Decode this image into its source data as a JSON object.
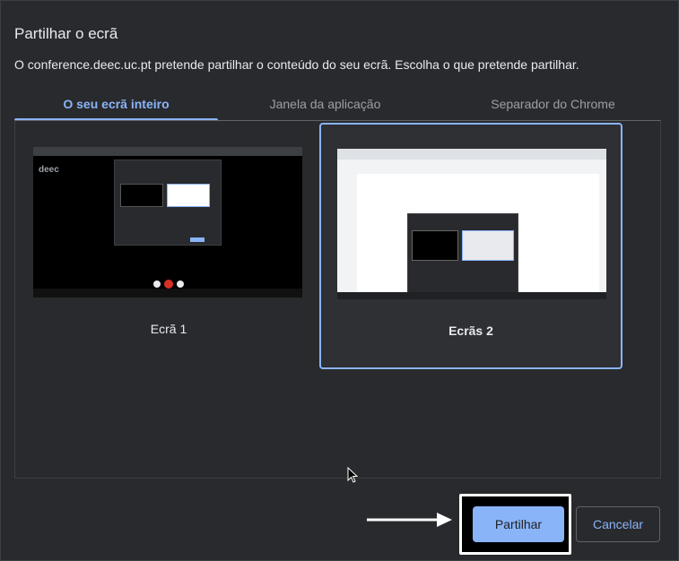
{
  "dialog": {
    "title": "Partilhar o ecrã",
    "subtitle": "O conference.deec.uc.pt pretende partilhar o conteúdo do seu ecrã. Escolha o que pretende partilhar."
  },
  "tabs": [
    {
      "label": "O seu ecrã inteiro",
      "active": true
    },
    {
      "label": "Janela da aplicação",
      "active": false
    },
    {
      "label": "Separador do Chrome",
      "active": false
    }
  ],
  "screens": [
    {
      "label": "Ecrã 1",
      "selected": false,
      "thumb_logo": "deec"
    },
    {
      "label": "Ecrãs 2",
      "selected": true
    }
  ],
  "buttons": {
    "share": "Partilhar",
    "cancel": "Cancelar"
  },
  "colors": {
    "accent": "#8ab4f8",
    "background": "#292a2d",
    "text": "#e8eaed",
    "muted": "#9aa0a6"
  },
  "icons": {
    "cursor": "mouse-pointer-icon",
    "annotation_arrow": "right-arrow-icon"
  }
}
